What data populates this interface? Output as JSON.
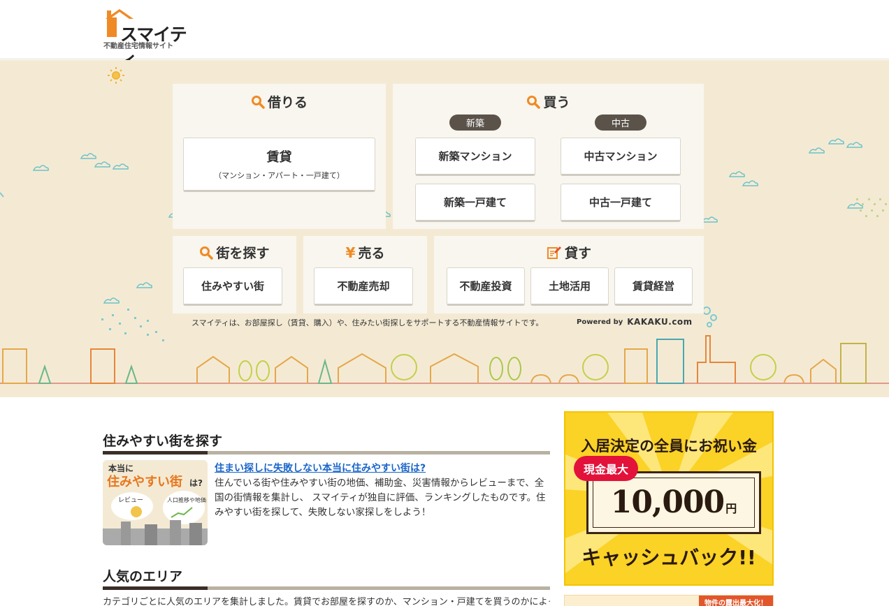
{
  "header": {
    "logo_name": "スマイティ",
    "logo_sub": "不動産住宅情報サイト"
  },
  "hero": {
    "rent": {
      "title": "借りる",
      "button_main": "賃貸",
      "button_sub": "（マンション・アパート・一戸建て）"
    },
    "buy": {
      "title": "買う",
      "new_label": "新築",
      "used_label": "中古",
      "buttons": [
        "新築マンション",
        "中古マンション",
        "新築一戸建て",
        "中古一戸建て"
      ]
    },
    "town": {
      "title": "街を探す",
      "button": "住みやすい街"
    },
    "sell": {
      "title": "売る",
      "button": "不動産売却"
    },
    "lend": {
      "title": "貸す",
      "buttons": [
        "不動産投資",
        "土地活用",
        "賃貸経営"
      ]
    },
    "tagline": "スマイティは、お部屋探し（賃貸、購入）や、住みたい街探しをサポートする不動産情報サイトです。",
    "powered_by": "Powered by",
    "powered_brand": "KAKAKU.com"
  },
  "main": {
    "section1": {
      "title": "住みやすい街を探す",
      "thumb_line1": "本当に",
      "thumb_line2": "住みやすい街",
      "thumb_line3": "は?",
      "thumb_bubble1": "レビュー",
      "thumb_bubble2": "人口推移や地価",
      "link": "住まい探しに失敗しない本当に住みやすい街は?",
      "text": "住んでいる街や住みやすい街の地価、補助金、災害情報からレビューまで、全国の街情報を集計し、 スマイティが独自に評価、ランキングしたものです。住みやすい街を探して、失敗しない家探しをしよう！"
    },
    "section2": {
      "title": "人気のエリア",
      "text": "カテゴリごとに人気のエリアを集計しました。賃貸でお部屋を探すのか、マンション・戸建てを買うのかによって人"
    }
  },
  "ad": {
    "title": "入居決定の全員にお祝い金",
    "badge": "現金最大",
    "amount": "10,000",
    "unit": "円",
    "footer": "キャッシュバック!!"
  },
  "ad2": {
    "ribbon": "物件の露出最大化！"
  },
  "colors": {
    "hero_bg": "#f4ead4",
    "panel_bg": "#f8f6ee",
    "accent_orange": "#f08a24",
    "link_blue": "#1a66c9",
    "ad_yellow": "#fbd226"
  }
}
